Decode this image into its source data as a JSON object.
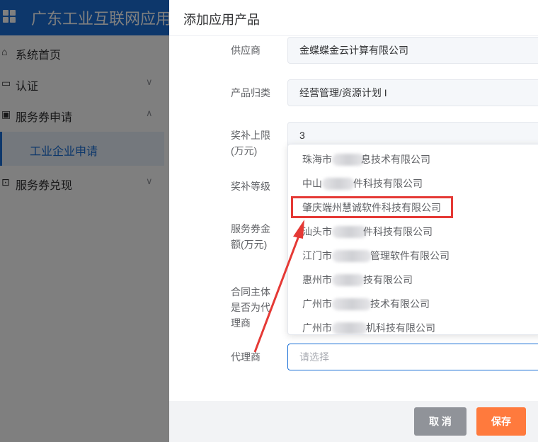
{
  "app": {
    "title": "广东工业互联网应用"
  },
  "sidebar": {
    "items": [
      {
        "label": "系统首页",
        "icon": "home-icon"
      },
      {
        "label": "认证",
        "icon": "certificate-icon"
      },
      {
        "label": "服务券申请",
        "icon": "ticket-icon"
      },
      {
        "label": "服务券兑现",
        "icon": "exchange-icon"
      }
    ],
    "sub_item": "工业企业申请"
  },
  "drawer": {
    "title": "添加应用产品",
    "fields": {
      "supplier": {
        "label": "供应商",
        "value": "金蝶蝶金云计算有限公司"
      },
      "category": {
        "label": "产品归类",
        "value": "经营管理/资源计划 I"
      },
      "subsidy_limit": {
        "label_line1": "奖补上限",
        "label_line2": "(万元)",
        "value": "3"
      },
      "subsidy_level": {
        "label": "奖补等级"
      },
      "voucher_amount": {
        "label_line1": "服务券金",
        "label_line2": "额(万元)"
      },
      "contract_agent": {
        "label_line1": "合同主体",
        "label_line2": "是否为代",
        "label_line3": "理商"
      },
      "agent": {
        "label": "代理商",
        "placeholder": "请选择"
      }
    },
    "dropdown_options": [
      {
        "prefix": "珠海市",
        "suffix": "息技术有限公司"
      },
      {
        "prefix": "中山",
        "suffix": "件科技有限公司"
      },
      {
        "prefix": "肇庆端州慧诚软件科技有限公司",
        "suffix": ""
      },
      {
        "prefix": "汕头市",
        "suffix": "件科技有限公司"
      },
      {
        "prefix": "江门市",
        "suffix": "管理软件有限公司"
      },
      {
        "prefix": "惠州市",
        "suffix": "技有限公司"
      },
      {
        "prefix": "广州市",
        "suffix": "技术有限公司"
      },
      {
        "prefix": "广州市",
        "suffix": "机科技有限公司"
      }
    ],
    "buttons": {
      "cancel": "取 消",
      "save": "保存"
    }
  },
  "colors": {
    "brand": "#1a6fd6",
    "save": "#ff7a3d",
    "cancel": "#909399",
    "highlight": "#e53935"
  }
}
